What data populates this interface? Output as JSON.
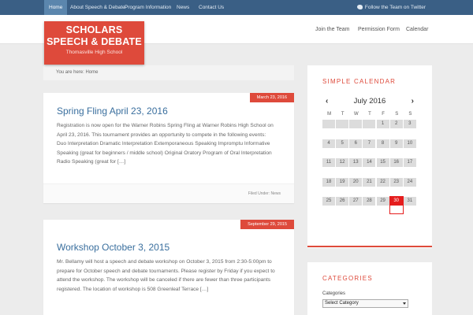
{
  "topnav": {
    "items": [
      "Home",
      "About Speech & Debate",
      "Program Information",
      "News",
      "Contact Us"
    ],
    "twitter_label": "Follow the Team on Twitter"
  },
  "logo": {
    "line1": "SCHOLARS",
    "line2": "SPEECH & DEBATE",
    "line3": "Thomasville High School"
  },
  "header_nav": [
    "Join the Team",
    "Permission Form",
    "Calendar"
  ],
  "breadcrumb": "You are here: Home",
  "posts": [
    {
      "date": "March 23, 2016",
      "title": "Spring Fling April 23, 2016",
      "lines": [
        "Registration is now open for the Warner Robins Spring Fling at Warner Robins High School on",
        "April 23, 2016.  This tournament provides an opportunity to compete in the following events:",
        "Duo Interpretation Dramatic Interpretation Extemporaneous Speaking Impromptu Informative",
        "Speaking (great for beginners / middle school) Original Oratory Program of Oral Interpretation",
        "Radio Speaking (great for […]"
      ],
      "filed": "Filed Under: News"
    },
    {
      "date": "September 29, 2015",
      "title": "Workshop October 3, 2015",
      "lines": [
        "Mr. Bellamy will host a speech and debate workshop on October 3, 2015 from 2:30-5:00pm to",
        "prepare for October speech and debate tournaments. Please register by Friday if you expect to",
        "attend the workshop. The workshop will be canceled if there are fewer than three participants",
        "registered. The location of workshop is 508 Greenleaf Terrace […]"
      ]
    }
  ],
  "calendar": {
    "title": "SIMPLE CALENDAR",
    "month": "July 2016",
    "prev": "‹",
    "next": "›",
    "days": [
      "M",
      "T",
      "W",
      "T",
      "F",
      "S",
      "S"
    ],
    "weeks": [
      [
        "",
        "",
        "",
        "",
        "1",
        "2",
        "3"
      ],
      [
        "4",
        "5",
        "6",
        "7",
        "8",
        "9",
        "10"
      ],
      [
        "11",
        "12",
        "13",
        "14",
        "15",
        "16",
        "17"
      ],
      [
        "18",
        "19",
        "20",
        "21",
        "22",
        "23",
        "24"
      ],
      [
        "25",
        "26",
        "27",
        "28",
        "29",
        "30",
        "31"
      ]
    ],
    "today": "30"
  },
  "categories": {
    "title": "CATEGORIES",
    "label": "Categories",
    "selected": "Select Category"
  }
}
